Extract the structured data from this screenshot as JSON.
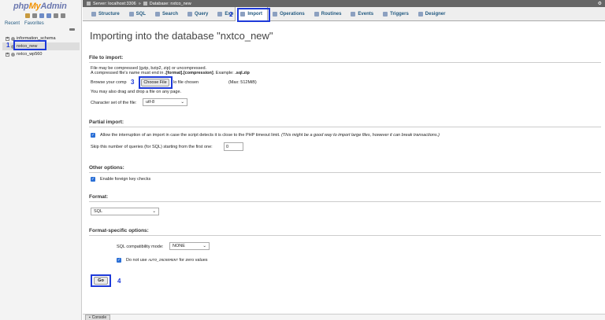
{
  "sidebar": {
    "logo_php": "php",
    "logo_my": "My",
    "logo_admin": "Admin",
    "recent": "Recent",
    "favorites": "Favorites",
    "databases": [
      "information_schema",
      "nxtco_new",
      "nxtco_wp560"
    ]
  },
  "topbar": {
    "breadcrumb_server": "Server: localhost:3306",
    "breadcrumb_sep": "»",
    "breadcrumb_db": "Database: nxtco_new"
  },
  "tabs": [
    "Structure",
    "SQL",
    "Search",
    "Query",
    "Export",
    "Import",
    "Operations",
    "Routines",
    "Events",
    "Triggers",
    "Designer"
  ],
  "tab_visible": {
    "export": "Exp"
  },
  "annotations": {
    "n1": "1",
    "n2": "2",
    "n3": "3",
    "n4": "4"
  },
  "main": {
    "title": "Importing into the database \"nxtco_new\"",
    "file_section": {
      "heading": "File to import:",
      "line1": "File may be compressed (gzip, bzip2, zip) or uncompressed.",
      "line2_a": "A compressed file's name must end in ",
      "line2_b": ".[format].[compression]",
      "line2_c": ". Example: ",
      "line2_d": ".sql.zip",
      "browse_label": "Browse your comp",
      "choose_file": "Choose File",
      "no_file": "lo file chosen",
      "max": "(Max: 512MiB)",
      "drag": "You may also drag and drop a file on any page.",
      "charset_label": "Character set of the file:",
      "charset_value": "utf-8"
    },
    "partial": {
      "heading": "Partial import:",
      "allow_a": "Allow the interruption of an import in case the script detects it is close to the PHP timeout limit. ",
      "allow_b": "(This might be a good way to import large files, however it can break transactions.)",
      "skip_label": "Skip this number of queries (for SQL) starting from the first one:",
      "skip_value": "0"
    },
    "other": {
      "heading": "Other options:",
      "fk": "Enable foreign key checks"
    },
    "format": {
      "heading": "Format:",
      "value": "SQL"
    },
    "format_specific": {
      "heading": "Format-specific options:",
      "compat_label": "SQL compatibility mode:",
      "compat_value": "NONE",
      "auto_a": "Do not use ",
      "auto_b": "AUTO_INCREMENT",
      "auto_c": " for zero values"
    },
    "go": "Go"
  },
  "console": "Console"
}
